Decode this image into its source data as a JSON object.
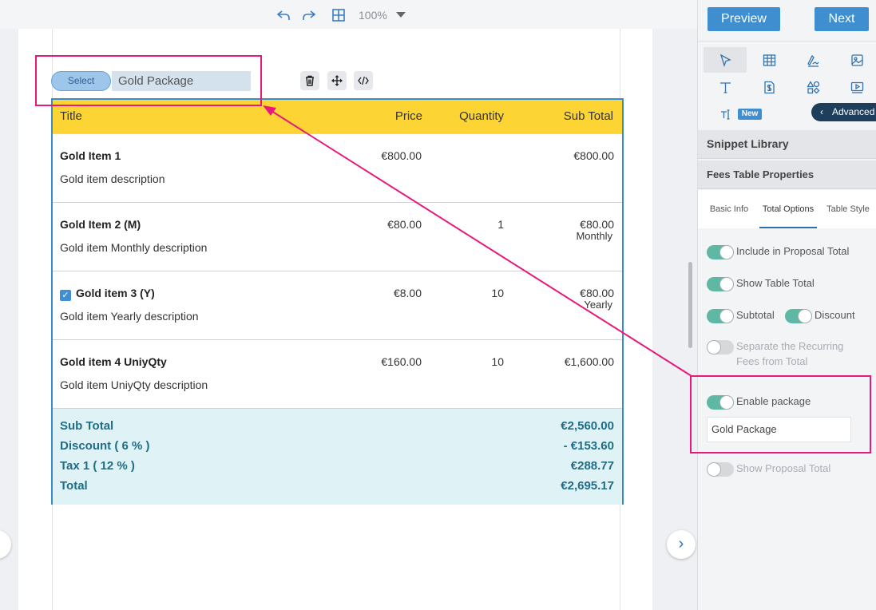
{
  "toolbar": {
    "zoom": "100%"
  },
  "package": {
    "select_label": "Select",
    "name": "Gold Package"
  },
  "table": {
    "headers": {
      "title": "Title",
      "price": "Price",
      "quantity": "Quantity",
      "subtotal": "Sub Total"
    },
    "rows": [
      {
        "name": "Gold Item 1",
        "description": "Gold item description",
        "price": "€800.00",
        "quantity": "",
        "subtotal": "€800.00",
        "subfreq": ""
      },
      {
        "name": "Gold Item 2 (M)",
        "description": "Gold item Monthly description",
        "price": "€80.00",
        "quantity": "1",
        "subtotal": "€80.00",
        "subfreq": "Monthly"
      },
      {
        "name": "Gold item 3 (Y)",
        "description": "Gold item Yearly description",
        "price": "€8.00",
        "quantity": "10",
        "subtotal": "€80.00",
        "subfreq": "Yearly",
        "checked": true
      },
      {
        "name": "Gold item 4 UniyQty",
        "description": "Gold item UniyQty description",
        "price": "€160.00",
        "quantity": "10",
        "subtotal": "€1,600.00",
        "subfreq": ""
      }
    ],
    "totals": {
      "subtotal_label": "Sub Total",
      "subtotal_value": "€2,560.00",
      "discount_label": "Discount ( 6 % )",
      "discount_value": "- €153.60",
      "tax_label": "Tax 1 ( 12 % )",
      "tax_value": "€288.77",
      "total_label": "Total",
      "total_value": "€2,695.17"
    }
  },
  "panel": {
    "preview_label": "Preview",
    "next_label": "Next",
    "new_badge": "New",
    "advanced_label": "Advanced",
    "snippet_library": "Snippet Library",
    "fees_props": "Fees Table Properties",
    "tabs": [
      "Basic Info",
      "Total Options",
      "Table Style"
    ],
    "options": {
      "include_proposal_total": "Include in Proposal Total",
      "show_table_total": "Show Table Total",
      "subtotal": "Subtotal",
      "discount": "Discount",
      "separate_recurring": "Separate the Recurring",
      "separate_recurring_2": "Fees from Total",
      "enable_package": "Enable package",
      "package_value": "Gold Package",
      "show_proposal_total": "Show Proposal Total"
    }
  },
  "colors": {
    "accent": "#3e8ed0",
    "header_yellow": "#fcd535",
    "toggle_on": "#5fb8a4",
    "annotation": "#e8197a",
    "totals_bg": "#dff2f5"
  },
  "icons": [
    "undo-icon",
    "redo-icon",
    "grid-icon",
    "trash-icon",
    "move-icon",
    "code-icon",
    "cursor-icon",
    "table-icon",
    "signature-icon",
    "image-icon",
    "text-icon",
    "price-icon",
    "shapes-icon",
    "video-icon",
    "textfield-icon"
  ]
}
